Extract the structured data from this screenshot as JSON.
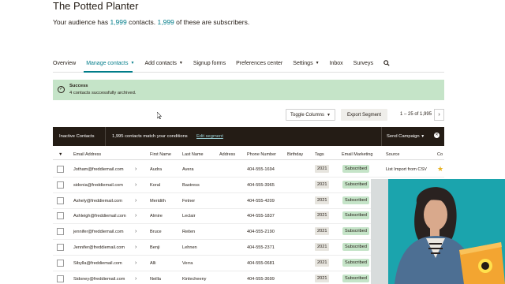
{
  "header": {
    "title": "The Potted Planter",
    "summary_prefix": "Your audience has ",
    "contacts_count": "1,999",
    "summary_mid": " contacts. ",
    "subscribers_count": "1,999",
    "summary_suffix": " of these are subscribers."
  },
  "nav": {
    "items": [
      {
        "label": "Overview"
      },
      {
        "label": "Manage contacts"
      },
      {
        "label": "Add contacts"
      },
      {
        "label": "Signup forms"
      },
      {
        "label": "Preferences center"
      },
      {
        "label": "Settings"
      },
      {
        "label": "Inbox"
      },
      {
        "label": "Surveys"
      }
    ]
  },
  "alert": {
    "title": "Success",
    "message": "4 contacts successfully archived."
  },
  "toolbar": {
    "toggle_columns": "Toggle Columns",
    "export_segment": "Export Segment",
    "pagination": "1 – 25 of 1,995"
  },
  "segment_bar": {
    "segment_name": "Inactive Contacts",
    "match_text": "1,995 contacts match your conditions",
    "edit_segment": "Edit segment",
    "send_campaign": "Send Campaign"
  },
  "table": {
    "headers": [
      "Email Address",
      "First Name",
      "Last Name",
      "Address",
      "Phone Number",
      "Birthday",
      "Tags",
      "Email Marketing",
      "Source",
      "Co"
    ],
    "rows": [
      {
        "email": "Jotham@freddiemail.com",
        "first": "Audra",
        "last": "Avera",
        "phone": "404-555-1694",
        "tag": "2021",
        "status": "Subscribed",
        "source": "List Import from CSV",
        "starred": true
      },
      {
        "email": "sidonia@freddiemail.com",
        "first": "Koral",
        "last": "Bastress",
        "phone": "404-555-3965",
        "tag": "2021",
        "status": "Subscribed",
        "source": "",
        "starred": false
      },
      {
        "email": "Ashely@freddiemail.com",
        "first": "Meridith",
        "last": "Fetner",
        "phone": "404-555-4209",
        "tag": "2021",
        "status": "Subscribed",
        "source": "",
        "starred": false
      },
      {
        "email": "Ashleigh@freddiemail.com",
        "first": "Almire",
        "last": "Leclair",
        "phone": "404-555-1837",
        "tag": "2021",
        "status": "Subscribed",
        "source": "",
        "starred": false
      },
      {
        "email": "jennifer@freddiemail.com",
        "first": "Bruce",
        "last": "Reiten",
        "phone": "404-555-2190",
        "tag": "2021",
        "status": "Subscribed",
        "source": "",
        "starred": false
      },
      {
        "email": "Jennifer@freddiemail.com",
        "first": "Benji",
        "last": "Lehnen",
        "phone": "404-555-2371",
        "tag": "2021",
        "status": "Subscribed",
        "source": "",
        "starred": false
      },
      {
        "email": "Sibylla@freddiemail.com",
        "first": "Alli",
        "last": "Verra",
        "phone": "404-555-0681",
        "tag": "2021",
        "status": "Subscribed",
        "source": "",
        "starred": false
      },
      {
        "email": "Sidoney@freddiemail.com",
        "first": "Neilla",
        "last": "Kinlecheeny",
        "phone": "404-555-3699",
        "tag": "2021",
        "status": "Subscribed",
        "source": "",
        "starred": false
      }
    ]
  },
  "colors": {
    "accent": "#007c89",
    "success_bg": "#c5e4c8",
    "dark_bar": "#241c15",
    "video_bg": "#1ba4ad"
  }
}
